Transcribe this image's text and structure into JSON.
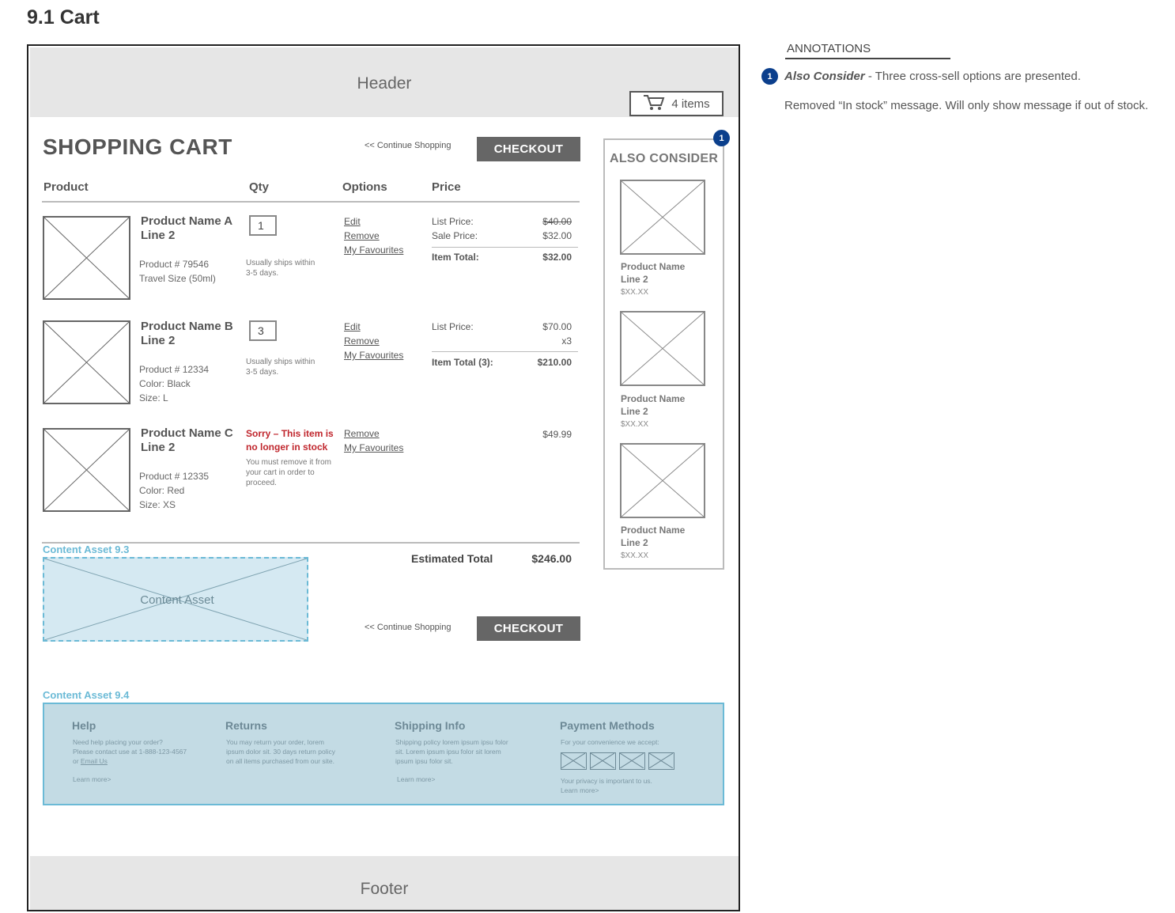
{
  "page_title": "9.1 Cart",
  "header": {
    "label": "Header",
    "cart_count": "4 items",
    "cart_icon": "shopping-cart-icon"
  },
  "footer": {
    "label": "Footer"
  },
  "cart": {
    "title": "SHOPPING CART",
    "continue_shopping": "<< Continue Shopping",
    "checkout": "CHECKOUT",
    "columns": [
      "Product",
      "Qty",
      "Options",
      "Price"
    ],
    "items": [
      {
        "name_line1": "Product Name A",
        "name_line2": "Line 2",
        "meta": [
          "Product # 79546",
          "Travel Size (50ml)"
        ],
        "qty": "1",
        "ship": [
          "Usually ships within",
          "3-5 days."
        ],
        "options": [
          "Edit",
          "Remove",
          "My Favourites"
        ],
        "price_rows": [
          {
            "label": "List Price:",
            "value": "$40.00"
          },
          {
            "label": "Sale Price:",
            "value": "$32.00"
          },
          {
            "label": "Item Total:",
            "value": "$32.00"
          }
        ]
      },
      {
        "name_line1": "Product Name B",
        "name_line2": "Line 2",
        "meta": [
          "Product # 12334",
          "Color: Black",
          "Size: L"
        ],
        "qty": "3",
        "ship": [
          "Usually ships within",
          "3-5 days."
        ],
        "options": [
          "Edit",
          "Remove",
          "My Favourites"
        ],
        "price_rows": [
          {
            "label": "List Price:",
            "value": "$70.00"
          },
          {
            "label": "",
            "value": "x3"
          },
          {
            "label": "Item Total (3):",
            "value": "$210.00"
          }
        ]
      },
      {
        "name_line1": "Product Name C",
        "name_line2": "Line 2",
        "meta": [
          "Product # 12335",
          "Color: Red",
          "Size: XS"
        ],
        "oos_line1": "Sorry – This item is",
        "oos_line2": "no longer in stock",
        "oos_note": [
          "You must remove it from",
          "your cart in order to",
          "proceed."
        ],
        "options": [
          "Remove",
          "My Favourites"
        ],
        "price": "$49.99"
      }
    ],
    "estimated_total_label": "Estimated Total",
    "estimated_total_value": "$246.00"
  },
  "content_asset_93": {
    "label": "Content Asset 9.3",
    "text": "Content Asset"
  },
  "also_consider": {
    "title": "ALSO CONSIDER",
    "badge": "1",
    "items": [
      {
        "name_line1": "Product Name",
        "name_line2": "Line 2",
        "price": "$XX.XX"
      },
      {
        "name_line1": "Product Name",
        "name_line2": "Line 2",
        "price": "$XX.XX"
      },
      {
        "name_line1": "Product Name",
        "name_line2": "Line 2",
        "price": "$XX.XX"
      }
    ]
  },
  "content_asset_94": {
    "label": "Content Asset 9.4",
    "help": {
      "title": "Help",
      "lines": [
        "Need help placing your order?",
        "Please contact use at 1-888-123-4567"
      ],
      "or": "or ",
      "email": "Email Us",
      "learn": "Learn more>"
    },
    "returns": {
      "title": "Returns",
      "lines": [
        "You may return your order, lorem",
        "ipsum dolor sit. 30 days return policy",
        "on all items purchased from our site."
      ]
    },
    "shipping": {
      "title": "Shipping Info",
      "lines": [
        "Shipping policy lorem ipsum ipsu folor",
        "sit. Lorem ipsum ipsu folor sit lorem",
        "ipsum ipsu folor sit."
      ],
      "learn": "Learn more>"
    },
    "payment": {
      "title": "Payment Methods",
      "intro": "For your convenience we accept:",
      "privacy": "Your privacy is important to us.",
      "learn": "Learn more>"
    }
  },
  "annotations": {
    "title": "ANNOTATIONS",
    "badge": "1",
    "item1_bold": "Also Consider",
    "item1_text": " - Three cross-sell options are presented.",
    "note": "Removed “In stock” message. Will only show message if out of stock."
  },
  "colors": {
    "badge": "#0b3f8c",
    "checkout": "#666666",
    "out_of_stock": "#c0262d",
    "content_asset": "#6bbad6"
  }
}
